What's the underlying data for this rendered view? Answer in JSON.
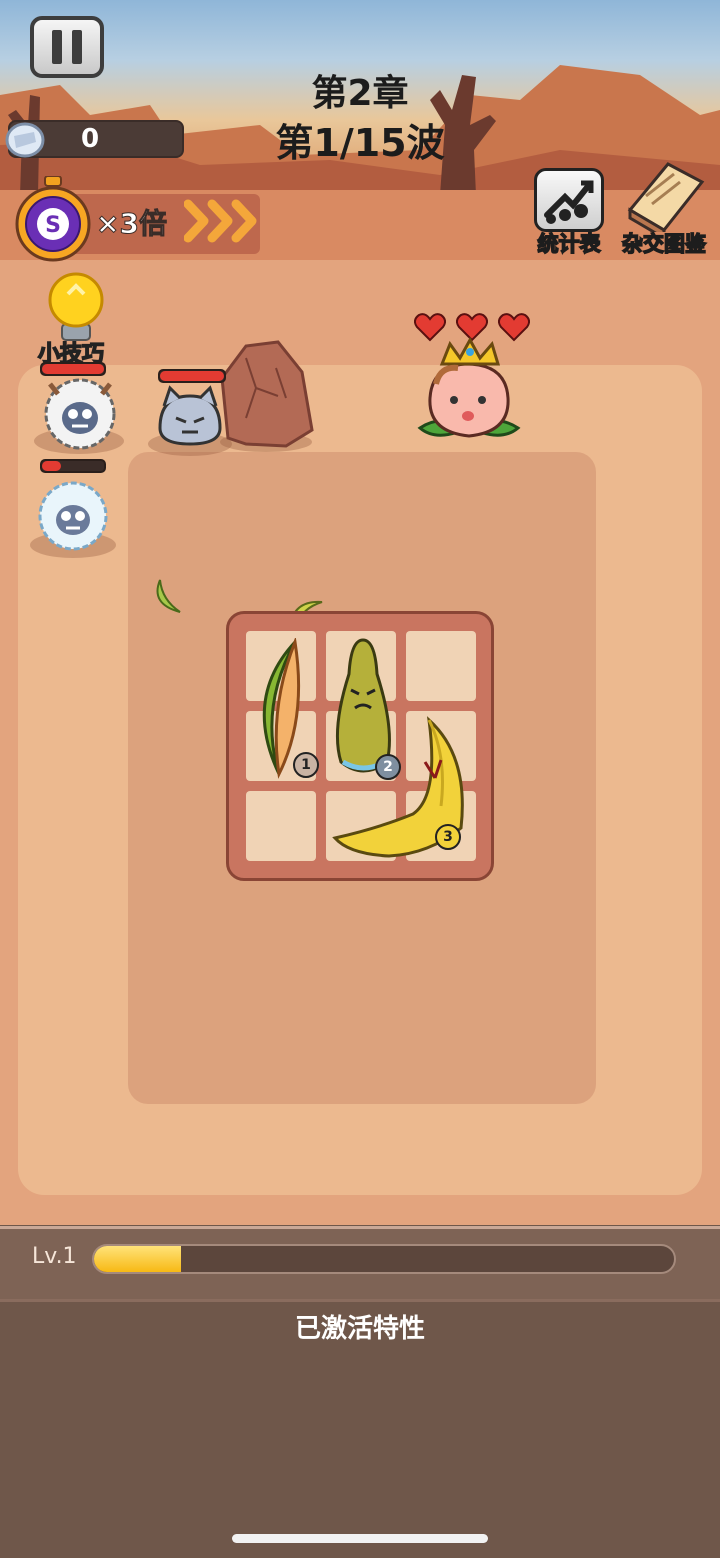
{
  "hud": {
    "chapter": "第2章",
    "wave": "第1/15波",
    "coins": "0",
    "speed_multiplier": "×3倍",
    "stats_label": "统计表",
    "hybrid_book_label": "杂交图鉴",
    "tip_label": "小技巧"
  },
  "player": {
    "hearts": 3,
    "character": "peach-princess"
  },
  "enemies": [
    {
      "type": "fluffy-sheep",
      "hp_fraction": 1.0
    },
    {
      "type": "gray-cat-slime",
      "hp_fraction": 1.0
    },
    {
      "type": "ice-fluffy-sheep",
      "hp_fraction": 0.3
    }
  ],
  "board": {
    "rows": 3,
    "cols": 3,
    "items": [
      {
        "name": "melon-slice",
        "level": "1"
      },
      {
        "name": "sad-pear",
        "level": "2"
      },
      {
        "name": "banana",
        "level": "3"
      }
    ]
  },
  "progress": {
    "level_label": "Lv.1",
    "xp_fraction": 0.15,
    "traits_label": "已激活特性"
  },
  "colors": {
    "ground": "#e3a47e",
    "arena": "#ecb98f",
    "board": "#c97560",
    "xp_fill": "#f7b914",
    "hp": "#e33b32"
  }
}
